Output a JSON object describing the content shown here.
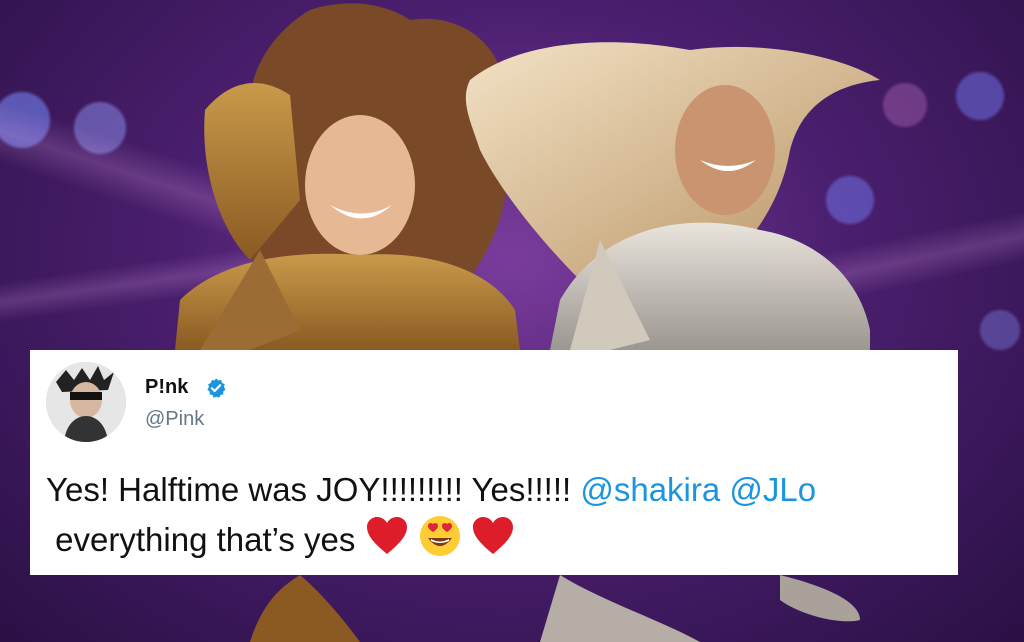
{
  "tweet": {
    "display_name": "P!nk",
    "handle": "@Pink",
    "verified_icon": "verified-badge-icon",
    "text_line1_start": "Yes! Halftime was JOY!!!!!!!!! Yes!!!!! ",
    "mention1": "@shakira",
    "mention2": "@JLo",
    "text_line2": "everything that’s yes",
    "emojis": [
      "red-heart-emoji",
      "heart-eyes-emoji",
      "red-heart-emoji"
    ],
    "accent_color": "#1b95e0"
  },
  "background_photo": "concert-performers-photo"
}
